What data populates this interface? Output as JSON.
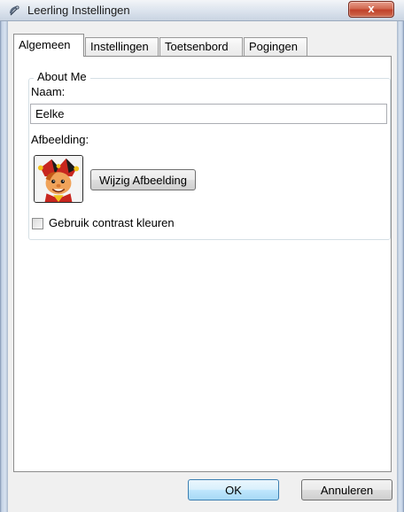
{
  "window": {
    "title": "Leerling Instellingen",
    "close_glyph": "x"
  },
  "tabs": [
    {
      "label": "Algemeen",
      "active": true
    },
    {
      "label": "Instellingen",
      "active": false
    },
    {
      "label": "Toetsenbord",
      "active": false
    },
    {
      "label": "Pogingen",
      "active": false
    }
  ],
  "about": {
    "group_title": "About Me",
    "name_label": "Naam:",
    "name_value": "Eelke",
    "image_label": "Afbeelding:",
    "change_image_button": "Wijzig Afbeelding",
    "contrast_checkbox_label": "Gebruik contrast kleuren",
    "contrast_checked": false
  },
  "footer": {
    "ok_label": "OK",
    "cancel_label": "Annuleren"
  },
  "icons": {
    "app": "app-icon",
    "close": "close-icon",
    "avatar": "jester-avatar-icon"
  }
}
